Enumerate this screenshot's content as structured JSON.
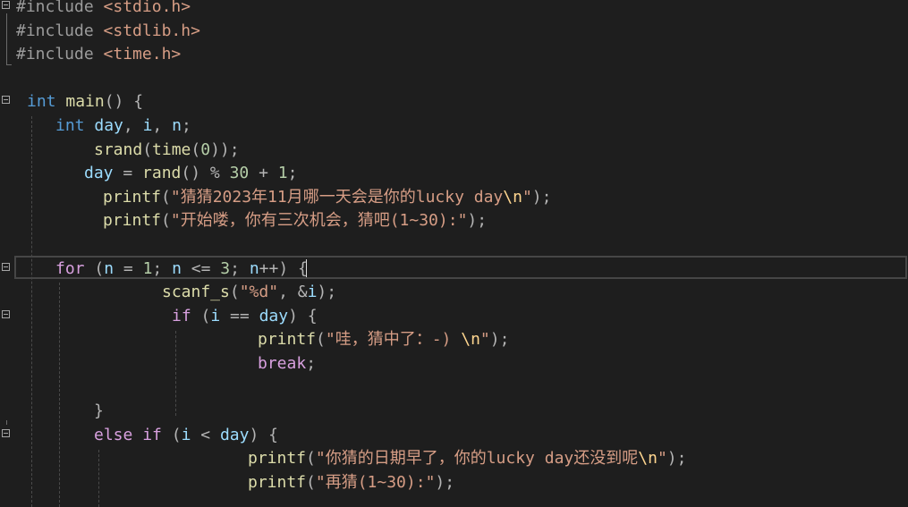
{
  "editor": {
    "lines": [
      {
        "fold": true,
        "indent": 18,
        "tokens": [
          [
            "pp",
            "#include "
          ],
          [
            "hdr",
            "<stdio.h>"
          ]
        ]
      },
      {
        "fold": false,
        "indent": 18,
        "tokens": [
          [
            "pp",
            "#include "
          ],
          [
            "hdr",
            "<stdlib.h>"
          ]
        ]
      },
      {
        "fold": false,
        "indent": 18,
        "tokens": [
          [
            "pp",
            "#include "
          ],
          [
            "hdr",
            "<time.h>"
          ]
        ]
      },
      {
        "fold": false,
        "indent": 18,
        "tokens": []
      },
      {
        "fold": true,
        "indent": 30,
        "tokens": [
          [
            "kw",
            "int"
          ],
          [
            "txt",
            " "
          ],
          [
            "fn",
            "main"
          ],
          [
            "pun",
            "() {"
          ]
        ]
      },
      {
        "fold": false,
        "indent": 62,
        "tokens": [
          [
            "kw",
            "int"
          ],
          [
            "txt",
            " "
          ],
          [
            "var",
            "day"
          ],
          [
            "pun",
            ", "
          ],
          [
            "var",
            "i"
          ],
          [
            "pun",
            ", "
          ],
          [
            "var",
            "n"
          ],
          [
            "pun",
            ";"
          ]
        ]
      },
      {
        "fold": false,
        "indent": 105,
        "tokens": [
          [
            "fn",
            "srand"
          ],
          [
            "pun",
            "("
          ],
          [
            "fn",
            "time"
          ],
          [
            "pun",
            "("
          ],
          [
            "num",
            "0"
          ],
          [
            "pun",
            "));"
          ]
        ]
      },
      {
        "fold": false,
        "indent": 94,
        "tokens": [
          [
            "var",
            "day"
          ],
          [
            "pun",
            " = "
          ],
          [
            "fn",
            "rand"
          ],
          [
            "pun",
            "() % "
          ],
          [
            "num",
            "30"
          ],
          [
            "pun",
            " + "
          ],
          [
            "num",
            "1"
          ],
          [
            "pun",
            ";"
          ]
        ]
      },
      {
        "fold": false,
        "indent": 115,
        "tokens": [
          [
            "fn",
            "printf"
          ],
          [
            "pun",
            "("
          ],
          [
            "str",
            "\"猜猜2023年11月哪一天会是你的lucky day"
          ],
          [
            "esc",
            "\\n"
          ],
          [
            "str",
            "\""
          ],
          [
            "pun",
            ");"
          ]
        ]
      },
      {
        "fold": false,
        "indent": 115,
        "tokens": [
          [
            "fn",
            "printf"
          ],
          [
            "pun",
            "("
          ],
          [
            "str",
            "\"开始喽，你有三次机会，猜吧(1~30):\""
          ],
          [
            "pun",
            ");"
          ]
        ]
      },
      {
        "fold": false,
        "indent": 62,
        "tokens": []
      },
      {
        "fold": true,
        "indent": 62,
        "tokens": [
          [
            "ctl",
            "for"
          ],
          [
            "pun",
            " ("
          ],
          [
            "var",
            "n"
          ],
          [
            "pun",
            " = "
          ],
          [
            "num",
            "1"
          ],
          [
            "pun",
            "; "
          ],
          [
            "var",
            "n"
          ],
          [
            "pun",
            " <= "
          ],
          [
            "num",
            "3"
          ],
          [
            "pun",
            "; "
          ],
          [
            "var",
            "n"
          ],
          [
            "pun",
            "++) {"
          ]
        ]
      },
      {
        "fold": false,
        "indent": 181,
        "tokens": [
          [
            "fn",
            "scanf_s"
          ],
          [
            "pun",
            "("
          ],
          [
            "str",
            "\"%d\""
          ],
          [
            "pun",
            ", &"
          ],
          [
            "var",
            "i"
          ],
          [
            "pun",
            ");"
          ]
        ]
      },
      {
        "fold": true,
        "indent": 192,
        "tokens": [
          [
            "ctl",
            "if"
          ],
          [
            "pun",
            " ("
          ],
          [
            "var",
            "i"
          ],
          [
            "pun",
            " == "
          ],
          [
            "var",
            "day"
          ],
          [
            "pun",
            ") {"
          ]
        ]
      },
      {
        "fold": false,
        "indent": 288,
        "tokens": [
          [
            "fn",
            "printf"
          ],
          [
            "pun",
            "("
          ],
          [
            "str",
            "\"哇，猜中了：-) "
          ],
          [
            "esc",
            "\\n"
          ],
          [
            "str",
            "\""
          ],
          [
            "pun",
            ");"
          ]
        ]
      },
      {
        "fold": false,
        "indent": 288,
        "tokens": [
          [
            "ctl",
            "break"
          ],
          [
            "pun",
            ";"
          ]
        ]
      },
      {
        "fold": false,
        "indent": 192,
        "tokens": []
      },
      {
        "fold": false,
        "indent": 105,
        "tokens": [
          [
            "pun",
            "}"
          ]
        ]
      },
      {
        "fold": true,
        "indent": 105,
        "tokens": [
          [
            "ctl",
            "else"
          ],
          [
            "txt",
            " "
          ],
          [
            "ctl",
            "if"
          ],
          [
            "pun",
            " ("
          ],
          [
            "var",
            "i"
          ],
          [
            "pun",
            " < "
          ],
          [
            "var",
            "day"
          ],
          [
            "pun",
            ") {"
          ]
        ]
      },
      {
        "fold": false,
        "indent": 277,
        "tokens": [
          [
            "fn",
            "printf"
          ],
          [
            "pun",
            "("
          ],
          [
            "str",
            "\"你猜的日期早了，你的lucky day还没到呢"
          ],
          [
            "esc",
            "\\n"
          ],
          [
            "str",
            "\""
          ],
          [
            "pun",
            ");"
          ]
        ]
      },
      {
        "fold": false,
        "indent": 277,
        "tokens": [
          [
            "fn",
            "printf"
          ],
          [
            "pun",
            "("
          ],
          [
            "str",
            "\"再猜(1~30):\""
          ],
          [
            "pun",
            ");"
          ]
        ]
      }
    ]
  }
}
